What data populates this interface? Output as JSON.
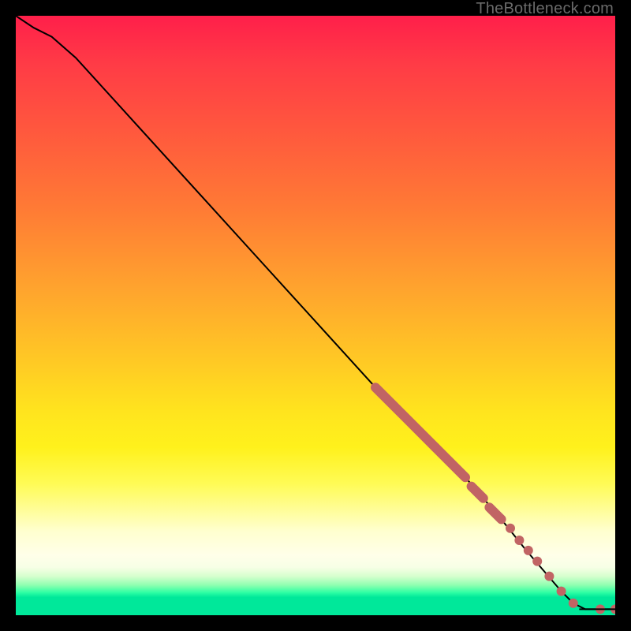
{
  "attribution": "TheBottleneck.com",
  "chart_data": {
    "type": "line",
    "title": "",
    "xlabel": "",
    "ylabel": "",
    "xlim": [
      0,
      100
    ],
    "ylim": [
      0,
      100
    ],
    "grid": false,
    "legend": false,
    "curve": [
      {
        "x": 0,
        "y": 100
      },
      {
        "x": 3,
        "y": 98
      },
      {
        "x": 6,
        "y": 96.5
      },
      {
        "x": 10,
        "y": 93
      },
      {
        "x": 20,
        "y": 82
      },
      {
        "x": 30,
        "y": 71
      },
      {
        "x": 40,
        "y": 60
      },
      {
        "x": 50,
        "y": 49
      },
      {
        "x": 60,
        "y": 38
      },
      {
        "x": 62,
        "y": 36
      },
      {
        "x": 70,
        "y": 28
      },
      {
        "x": 75,
        "y": 23
      },
      {
        "x": 78,
        "y": 19.5
      },
      {
        "x": 81,
        "y": 16
      },
      {
        "x": 83,
        "y": 13.5
      },
      {
        "x": 85,
        "y": 11
      },
      {
        "x": 88,
        "y": 7.5
      },
      {
        "x": 91,
        "y": 4
      },
      {
        "x": 93,
        "y": 2
      },
      {
        "x": 95,
        "y": 1
      },
      {
        "x": 98,
        "y": 1
      },
      {
        "x": 100,
        "y": 1
      }
    ],
    "highlight_segments": [
      {
        "x1": 60,
        "y1": 38,
        "x2": 70,
        "y2": 28
      },
      {
        "x1": 70,
        "y1": 28,
        "x2": 75,
        "y2": 23
      },
      {
        "x1": 76,
        "y1": 21.5,
        "x2": 78,
        "y2": 19.5
      },
      {
        "x1": 79,
        "y1": 18,
        "x2": 81,
        "y2": 16
      }
    ],
    "highlight_points": [
      {
        "x": 82.5,
        "y": 14.5
      },
      {
        "x": 84,
        "y": 12.5
      },
      {
        "x": 85.5,
        "y": 10.8
      },
      {
        "x": 87,
        "y": 9
      },
      {
        "x": 89,
        "y": 6.5
      },
      {
        "x": 91,
        "y": 4
      },
      {
        "x": 93,
        "y": 2
      },
      {
        "x": 97.5,
        "y": 1
      },
      {
        "x": 100,
        "y": 1
      }
    ],
    "marker_color": "#c16464",
    "curve_color": "#000000"
  }
}
